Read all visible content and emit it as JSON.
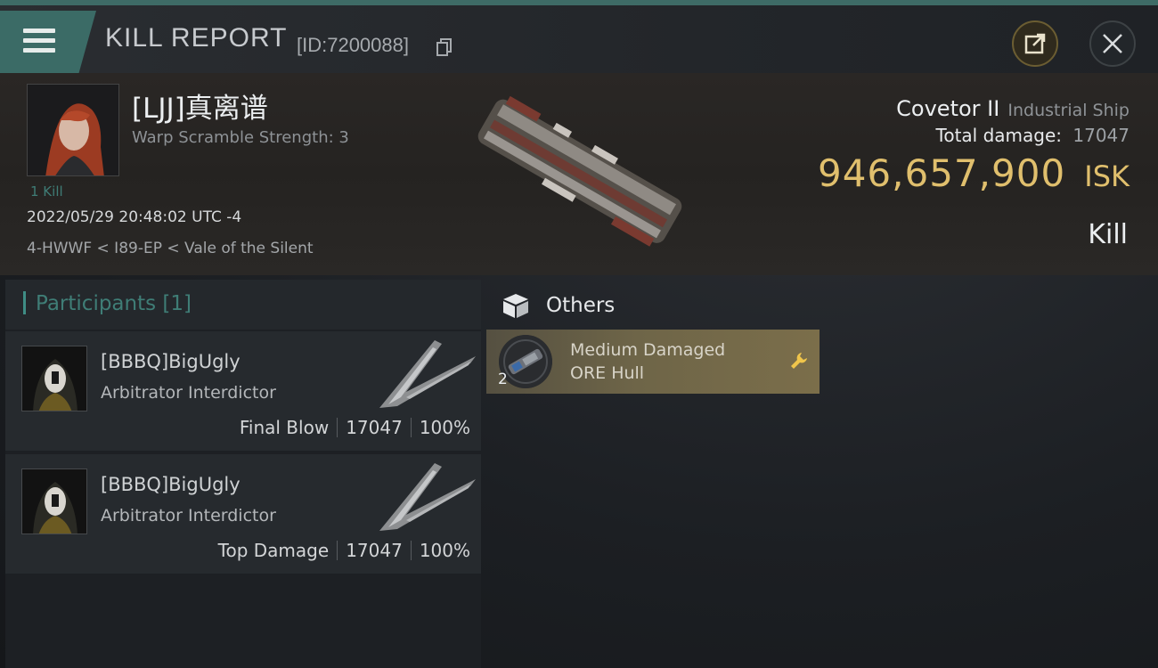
{
  "header": {
    "title": "KILL REPORT",
    "report_id": "[ID:7200088]",
    "menu_icon": "hamburger-menu-icon",
    "share_icon": "share-export-icon",
    "close_icon": "close-icon"
  },
  "victim": {
    "name": "[LJJ]真离谱",
    "warp_scramble": "Warp Scramble Strength: 3",
    "kill_count": "1 Kill",
    "datetime": "2022/05/29 20:48:02 UTC -4",
    "location": "4-HWWF < I89-EP < Vale of the Silent",
    "ship_name": "Covetor II",
    "ship_class": "Industrial Ship",
    "damage_label": "Total damage:",
    "damage_value": "17047",
    "isk_value": "946,657,900",
    "isk_unit": "ISK",
    "result": "Kill"
  },
  "participants": {
    "title": "Participants [1]",
    "rows": [
      {
        "name": "[BBBQ]BigUgly",
        "ship": "Arbitrator Interdictor",
        "role": "Final Blow",
        "damage": "17047",
        "percent": "100%"
      },
      {
        "name": "[BBBQ]BigUgly",
        "ship": "Arbitrator Interdictor",
        "role": "Top Damage",
        "damage": "17047",
        "percent": "100%"
      }
    ]
  },
  "others": {
    "title": "Others",
    "items": [
      {
        "name": "Medium Damaged",
        "type": "ORE Hull",
        "quantity": "2"
      }
    ]
  },
  "colors": {
    "accent_teal": "#3b6b66",
    "isk_gold": "#e0bf6d",
    "card_gold": "#6e6548"
  }
}
